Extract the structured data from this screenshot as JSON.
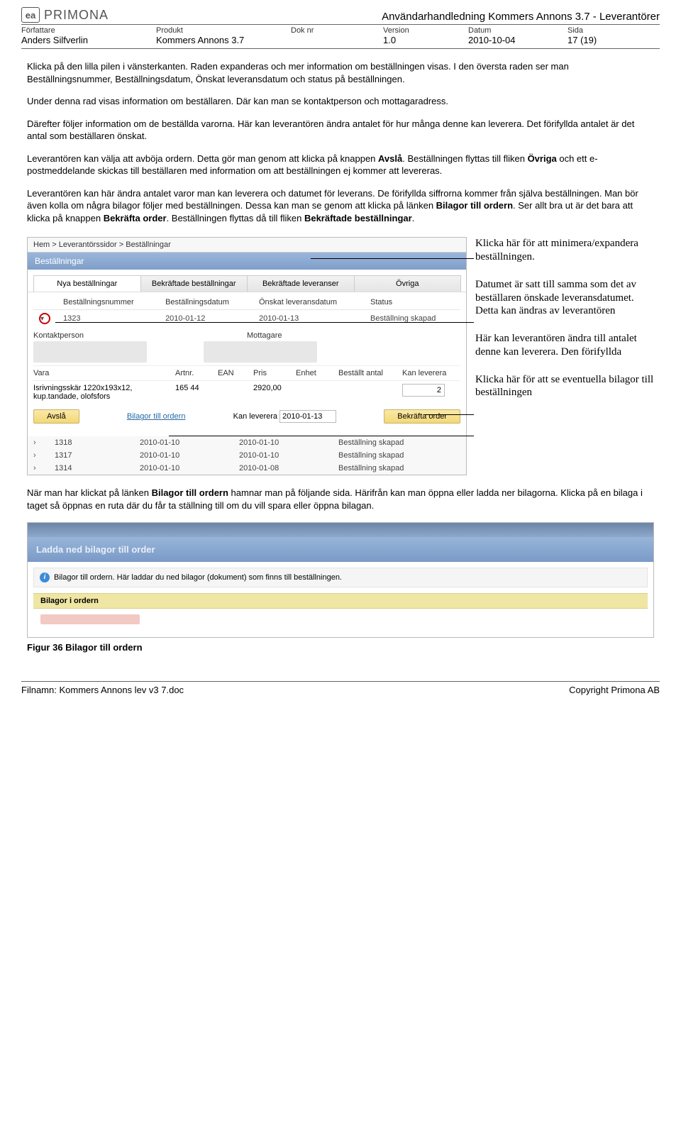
{
  "header": {
    "logo_text": "PRIMONA",
    "doc_title_right": "Användarhandledning Kommers Annons 3.7 - Leverantörer",
    "labels": {
      "forfattare": "Författare",
      "produkt": "Produkt",
      "doknr": "Dok nr",
      "version": "Version",
      "datum": "Datum",
      "sida": "Sida"
    },
    "values": {
      "forfattare": "Anders Silfverlin",
      "produkt": "Kommers Annons 3.7",
      "doknr": "",
      "version": "1.0",
      "datum": "2010-10-04",
      "sida": "17 (19)"
    }
  },
  "body": {
    "p1": "Klicka på den lilla pilen i vänsterkanten. Raden expanderas och mer information om beställningen visas. I den översta raden ser man Beställningsnummer, Beställningsdatum, Önskat leveransdatum och status på beställningen.",
    "p2": "Under denna rad visas information om beställaren. Där kan man se kontaktperson och mottagaradress.",
    "p3": "Därefter följer information om de beställda varorna. Här kan leverantören ändra antalet för hur många denne kan leverera. Det förifyllda antalet är det antal som beställaren önskat.",
    "p4_a": "Leverantören kan välja att avböja ordern. Detta gör man genom att klicka på knappen ",
    "p4_b": "Avslå",
    "p4_c": ". Beställningen flyttas till fliken ",
    "p4_d": "Övriga",
    "p4_e": " och ett e-postmeddelande skickas till beställaren med information om att beställningen ej kommer att levereras.",
    "p5_a": "Leverantören kan här ändra antalet varor man kan leverera och datumet för leverans. De förifyllda siffrorna kommer från själva beställningen. Man bör även kolla om några bilagor följer med beställningen. Dessa kan man se genom att klicka på länken ",
    "p5_b": "Bilagor till ordern",
    "p5_c": ". Ser allt bra ut är det bara att klicka på knappen ",
    "p5_d": "Bekräfta order",
    "p5_e": ". Beställningen flyttas då till fliken ",
    "p5_f": "Bekräftade beställningar",
    "p5_g": "."
  },
  "screenshot1": {
    "breadcrumb": "Hem > Leverantörssidor > Beställningar",
    "panel_title": "Beställningar",
    "tabs": [
      "Nya beställningar",
      "Bekräftade beställningar",
      "Bekräftade leveranser",
      "Övriga"
    ],
    "columns": [
      "Beställningsnummer",
      "Beställningsdatum",
      "Önskat leveransdatum",
      "Status"
    ],
    "row": {
      "nr": "1323",
      "bd": "2010-01-12",
      "ld": "2010-01-13",
      "st": "Beställning skapad"
    },
    "kontakt_h": "Kontaktperson",
    "mottag_h": "Mottagare",
    "item_cols": [
      "Vara",
      "Artnr.",
      "EAN",
      "Pris",
      "Enhet",
      "Beställt antal",
      "Kan leverera"
    ],
    "item": {
      "name": "Isrivningsskär 1220x193x12, kup.tandade, olofsfors",
      "artnr": "165 44",
      "pris": "2920,00",
      "lev": "2"
    },
    "btn_reject": "Avslå",
    "link_bilagor": "Bilagor till ordern",
    "kan_lev_label": "Kan leverera",
    "kan_lev_date": "2010-01-13",
    "btn_confirm": "Bekräfta order",
    "extra": [
      {
        "nr": "1318",
        "bd": "2010-01-10",
        "ld": "2010-01-10",
        "st": "Beställning skapad"
      },
      {
        "nr": "1317",
        "bd": "2010-01-10",
        "ld": "2010-01-10",
        "st": "Beställning skapad"
      },
      {
        "nr": "1314",
        "bd": "2010-01-10",
        "ld": "2010-01-08",
        "st": "Beställning skapad"
      }
    ]
  },
  "callouts": {
    "c1": "Klicka här för att minimera/expandera beställningen.",
    "c2": "Datumet är satt till samma som det av beställaren önskade leveransdatumet. Detta kan ändras av leverantören",
    "c3": "Här kan leverantören ändra till antalet denne kan leverera. Den förifyllda",
    "c4": "Klicka här för att se eventuella bilagor till beställningen"
  },
  "between_shots": {
    "p_a": "När man har klickat på länken ",
    "p_b": "Bilagor till ordern",
    "p_c": " hamnar man på följande sida. Härifrån kan man öppna eller ladda ner bilagorna. Klicka på en bilaga i taget så öppnas en ruta där du får ta ställning till om du vill spara eller öppna bilagan."
  },
  "screenshot2": {
    "banner": "Ladda ned bilagor till order",
    "info": "Bilagor till ordern. Här laddar du ned bilagor (dokument) som finns till beställningen.",
    "bin_head": "Bilagor i ordern"
  },
  "fig_caption": "Figur 36 Bilagor till ordern",
  "footer": {
    "left": "Filnamn: Kommers Annons lev v3 7.doc",
    "right": "Copyright Primona AB"
  }
}
